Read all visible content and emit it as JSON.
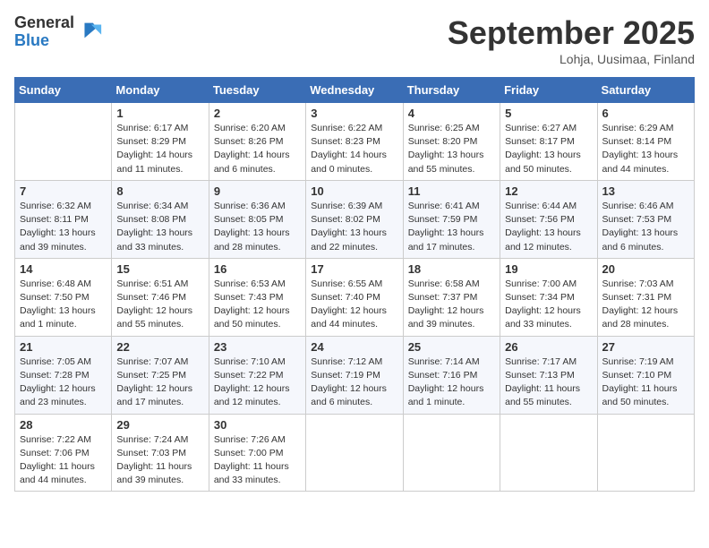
{
  "logo": {
    "general": "General",
    "blue": "Blue"
  },
  "title": "September 2025",
  "location": "Lohja, Uusimaa, Finland",
  "weekdays": [
    "Sunday",
    "Monday",
    "Tuesday",
    "Wednesday",
    "Thursday",
    "Friday",
    "Saturday"
  ],
  "weeks": [
    [
      {
        "day": "",
        "info": ""
      },
      {
        "day": "1",
        "info": "Sunrise: 6:17 AM\nSunset: 8:29 PM\nDaylight: 14 hours\nand 11 minutes."
      },
      {
        "day": "2",
        "info": "Sunrise: 6:20 AM\nSunset: 8:26 PM\nDaylight: 14 hours\nand 6 minutes."
      },
      {
        "day": "3",
        "info": "Sunrise: 6:22 AM\nSunset: 8:23 PM\nDaylight: 14 hours\nand 0 minutes."
      },
      {
        "day": "4",
        "info": "Sunrise: 6:25 AM\nSunset: 8:20 PM\nDaylight: 13 hours\nand 55 minutes."
      },
      {
        "day": "5",
        "info": "Sunrise: 6:27 AM\nSunset: 8:17 PM\nDaylight: 13 hours\nand 50 minutes."
      },
      {
        "day": "6",
        "info": "Sunrise: 6:29 AM\nSunset: 8:14 PM\nDaylight: 13 hours\nand 44 minutes."
      }
    ],
    [
      {
        "day": "7",
        "info": "Sunrise: 6:32 AM\nSunset: 8:11 PM\nDaylight: 13 hours\nand 39 minutes."
      },
      {
        "day": "8",
        "info": "Sunrise: 6:34 AM\nSunset: 8:08 PM\nDaylight: 13 hours\nand 33 minutes."
      },
      {
        "day": "9",
        "info": "Sunrise: 6:36 AM\nSunset: 8:05 PM\nDaylight: 13 hours\nand 28 minutes."
      },
      {
        "day": "10",
        "info": "Sunrise: 6:39 AM\nSunset: 8:02 PM\nDaylight: 13 hours\nand 22 minutes."
      },
      {
        "day": "11",
        "info": "Sunrise: 6:41 AM\nSunset: 7:59 PM\nDaylight: 13 hours\nand 17 minutes."
      },
      {
        "day": "12",
        "info": "Sunrise: 6:44 AM\nSunset: 7:56 PM\nDaylight: 13 hours\nand 12 minutes."
      },
      {
        "day": "13",
        "info": "Sunrise: 6:46 AM\nSunset: 7:53 PM\nDaylight: 13 hours\nand 6 minutes."
      }
    ],
    [
      {
        "day": "14",
        "info": "Sunrise: 6:48 AM\nSunset: 7:50 PM\nDaylight: 13 hours\nand 1 minute."
      },
      {
        "day": "15",
        "info": "Sunrise: 6:51 AM\nSunset: 7:46 PM\nDaylight: 12 hours\nand 55 minutes."
      },
      {
        "day": "16",
        "info": "Sunrise: 6:53 AM\nSunset: 7:43 PM\nDaylight: 12 hours\nand 50 minutes."
      },
      {
        "day": "17",
        "info": "Sunrise: 6:55 AM\nSunset: 7:40 PM\nDaylight: 12 hours\nand 44 minutes."
      },
      {
        "day": "18",
        "info": "Sunrise: 6:58 AM\nSunset: 7:37 PM\nDaylight: 12 hours\nand 39 minutes."
      },
      {
        "day": "19",
        "info": "Sunrise: 7:00 AM\nSunset: 7:34 PM\nDaylight: 12 hours\nand 33 minutes."
      },
      {
        "day": "20",
        "info": "Sunrise: 7:03 AM\nSunset: 7:31 PM\nDaylight: 12 hours\nand 28 minutes."
      }
    ],
    [
      {
        "day": "21",
        "info": "Sunrise: 7:05 AM\nSunset: 7:28 PM\nDaylight: 12 hours\nand 23 minutes."
      },
      {
        "day": "22",
        "info": "Sunrise: 7:07 AM\nSunset: 7:25 PM\nDaylight: 12 hours\nand 17 minutes."
      },
      {
        "day": "23",
        "info": "Sunrise: 7:10 AM\nSunset: 7:22 PM\nDaylight: 12 hours\nand 12 minutes."
      },
      {
        "day": "24",
        "info": "Sunrise: 7:12 AM\nSunset: 7:19 PM\nDaylight: 12 hours\nand 6 minutes."
      },
      {
        "day": "25",
        "info": "Sunrise: 7:14 AM\nSunset: 7:16 PM\nDaylight: 12 hours\nand 1 minute."
      },
      {
        "day": "26",
        "info": "Sunrise: 7:17 AM\nSunset: 7:13 PM\nDaylight: 11 hours\nand 55 minutes."
      },
      {
        "day": "27",
        "info": "Sunrise: 7:19 AM\nSunset: 7:10 PM\nDaylight: 11 hours\nand 50 minutes."
      }
    ],
    [
      {
        "day": "28",
        "info": "Sunrise: 7:22 AM\nSunset: 7:06 PM\nDaylight: 11 hours\nand 44 minutes."
      },
      {
        "day": "29",
        "info": "Sunrise: 7:24 AM\nSunset: 7:03 PM\nDaylight: 11 hours\nand 39 minutes."
      },
      {
        "day": "30",
        "info": "Sunrise: 7:26 AM\nSunset: 7:00 PM\nDaylight: 11 hours\nand 33 minutes."
      },
      {
        "day": "",
        "info": ""
      },
      {
        "day": "",
        "info": ""
      },
      {
        "day": "",
        "info": ""
      },
      {
        "day": "",
        "info": ""
      }
    ]
  ]
}
